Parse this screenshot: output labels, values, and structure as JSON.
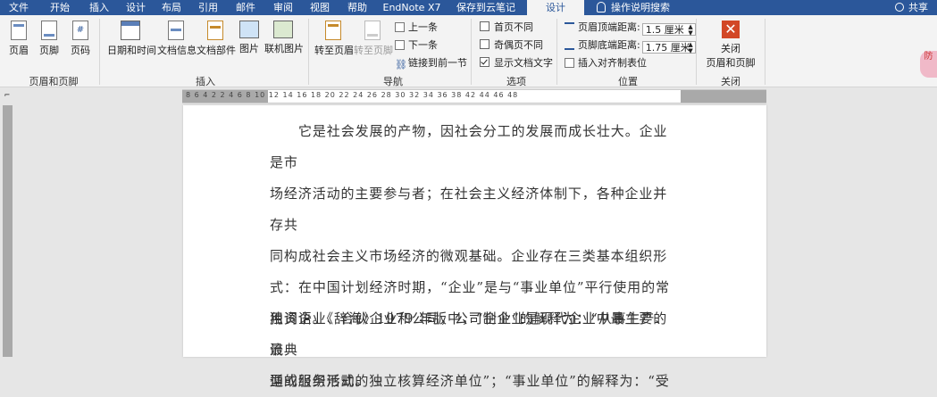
{
  "menu_tabs": [
    "文件",
    "开始",
    "插入",
    "设计",
    "布局",
    "引用",
    "邮件",
    "审阅",
    "视图",
    "帮助",
    "EndNote X7",
    "保存到云笔记",
    "设计"
  ],
  "tell_me": "操作说明搜索",
  "share": "共享",
  "ribbon": {
    "header_footer": {
      "header": "页眉",
      "footer": "页脚",
      "page_number": "页码",
      "group": "页眉和页脚"
    },
    "insert": {
      "date_time": "日期和时间",
      "doc_info": "文档信息",
      "doc_parts": "文档部件",
      "picture": "图片",
      "online_picture": "联机图片",
      "group": "插入"
    },
    "navigation": {
      "goto_header": "转至页眉",
      "goto_footer": "转至页脚",
      "previous": "上一条",
      "next": "下一条",
      "link_previous": "链接到前一节",
      "group": "导航"
    },
    "options": {
      "first_page_diff": "首页不同",
      "odd_even_diff": "奇偶页不同",
      "show_doc_text": "显示文档文字",
      "group": "选项"
    },
    "position": {
      "header_top_label": "页眉顶端距离:",
      "header_top_value": "1.5 厘米",
      "footer_bottom_label": "页脚底端距离:",
      "footer_bottom_value": "1.75 厘米",
      "insert_align_tab": "插入对齐制表位",
      "group": "位置"
    },
    "close": {
      "close_label_1": "关闭",
      "close_label_2": "页眉和页脚",
      "group": "关闭"
    }
  },
  "ruler_h": "8  6  4  2     2  4  6  8  10  12  14  16  18  20  22  24  26  28  30  32  34  36  38    42  44  46  48",
  "document": {
    "p1_lines": [
      "它是社会发展的产物，因社会分工的发展而成长壮大。企业是市",
      "场经济活动的主要参与者；在社会主义经济体制下，各种企业并存共",
      "同构成社会主义市场经济的微观基础。企业存在三类基本组织形式：",
      "独资企业、合伙企业和公司，公司制企业是现代企业中最主要的最典",
      "型的组织形式。"
    ],
    "p2_lines": [
      "在中国计划经济时期，“企业”是与“事业单位”平行使用的常",
      "用词语。《辞海》1979 年版中，“企业”的解释为：“从事生产、流",
      "通或服务活动的独立核算经济单位”；“事业单位”的解释为：“受"
    ],
    "pilcrow": "↵"
  },
  "side_badge": "防"
}
